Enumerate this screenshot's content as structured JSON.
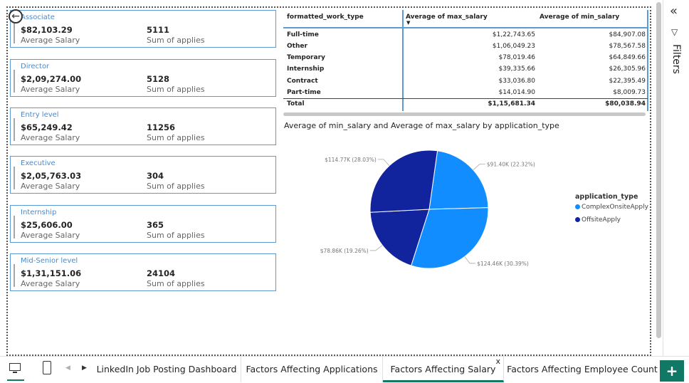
{
  "cards": [
    {
      "level": "Associate",
      "salary": "$82,103.29",
      "salary_label": "Average Salary",
      "applies": "5111",
      "applies_label": "Sum of applies"
    },
    {
      "level": "Director",
      "salary": "$2,09,274.00",
      "salary_label": "Average Salary",
      "applies": "5128",
      "applies_label": "Sum of applies"
    },
    {
      "level": "Entry level",
      "salary": "$65,249.42",
      "salary_label": "Average Salary",
      "applies": "11256",
      "applies_label": "Sum of applies"
    },
    {
      "level": "Executive",
      "salary": "$2,05,763.03",
      "salary_label": "Average Salary",
      "applies": "304",
      "applies_label": "Sum of applies"
    },
    {
      "level": "Internship",
      "salary": "$25,606.00",
      "salary_label": "Average Salary",
      "applies": "365",
      "applies_label": "Sum of applies"
    },
    {
      "level": "Mid-Senior level",
      "salary": "$1,31,151.06",
      "salary_label": "Average Salary",
      "applies": "24104",
      "applies_label": "Sum of applies"
    }
  ],
  "table": {
    "headers": [
      "formatted_work_type",
      "Average of max_salary",
      "Average of min_salary"
    ],
    "rows": [
      [
        "Full-time",
        "$1,22,743.65",
        "$84,907.08"
      ],
      [
        "Other",
        "$1,06,049.23",
        "$78,567.58"
      ],
      [
        "Temporary",
        "$78,019.46",
        "$64,849.66"
      ],
      [
        "Internship",
        "$39,335.66",
        "$26,305.96"
      ],
      [
        "Contract",
        "$33,036.80",
        "$22,395.49"
      ],
      [
        "Part-time",
        "$14,014.90",
        "$8,009.73"
      ]
    ],
    "total": [
      "Total",
      "$1,15,681.34",
      "$80,038.94"
    ]
  },
  "chart_data": {
    "type": "pie",
    "title": "Average of min_salary and Average of max_salary by application_type",
    "legend_title": "application_type",
    "legend_position": "right",
    "slices": [
      {
        "label": "$91.40K (22.32%)",
        "value": 91.4,
        "percent": 22.32,
        "series": "ComplexOnsiteApply",
        "color": "#118dff"
      },
      {
        "label": "$124.46K (30.39%)",
        "value": 124.46,
        "percent": 30.39,
        "series": "ComplexOnsiteApply",
        "color": "#118dff"
      },
      {
        "label": "$78.86K (19.26%)",
        "value": 78.86,
        "percent": 19.26,
        "series": "OffsiteApply",
        "color": "#12239e"
      },
      {
        "label": "$114.77K (28.03%)",
        "value": 114.77,
        "percent": 28.03,
        "series": "OffsiteApply",
        "color": "#12239e"
      }
    ],
    "legend": [
      {
        "name": "ComplexOnsiteApply",
        "color": "#118dff"
      },
      {
        "name": "OffsiteApply",
        "color": "#12239e"
      }
    ]
  },
  "filters": {
    "label": "Filters",
    "collapse_icon": "double-chevron-left-icon",
    "filter_icon": "funnel-icon"
  },
  "tabs": [
    {
      "label": "LinkedIn Job Posting Dashboard",
      "active": false
    },
    {
      "label": "Factors Affecting Applications",
      "active": false
    },
    {
      "label": "Factors Affecting Salary",
      "active": true,
      "close": "x"
    },
    {
      "label": "Factors Affecting Employee Count",
      "active": false
    }
  ],
  "add_label": "+",
  "colors": {
    "accent": "#117865",
    "card_border": "#5b9bd5",
    "pie_light": "#118dff",
    "pie_dark": "#12239e"
  }
}
